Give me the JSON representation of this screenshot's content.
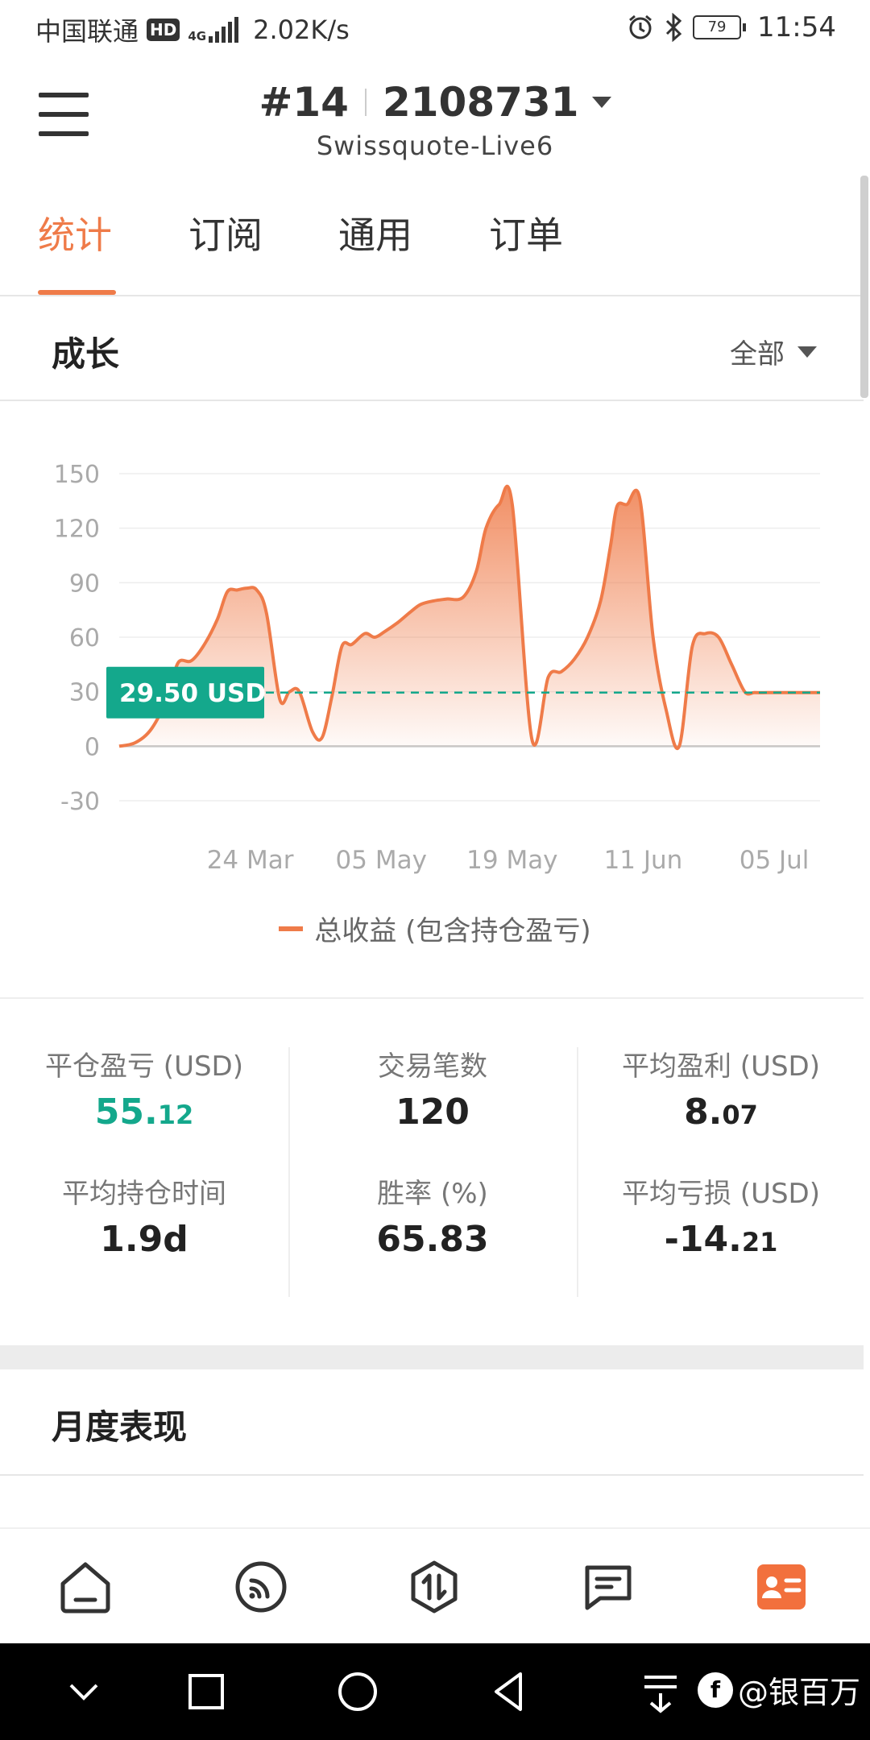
{
  "status_bar": {
    "carrier": "中国联通",
    "hd": "HD",
    "network": "4G",
    "speed": "2.02K/s",
    "battery": "79",
    "time": "11:54"
  },
  "header": {
    "account_index": "#14",
    "account_number": "2108731",
    "server": "Swissquote-Live6"
  },
  "tabs": [
    {
      "label": "统计",
      "active": true
    },
    {
      "label": "订阅",
      "active": false
    },
    {
      "label": "通用",
      "active": false
    },
    {
      "label": "订单",
      "active": false
    }
  ],
  "growth": {
    "title": "成长",
    "filter": "全部"
  },
  "chart_data": {
    "type": "area",
    "legend": "总收益 (包含持仓盈亏)",
    "series_color": "#ef7b49",
    "current_value_label": "29.50 USD",
    "current_value": 29.5,
    "ylim": [
      -30,
      150
    ],
    "y_ticks": [
      150,
      120,
      90,
      60,
      30,
      0,
      -30
    ],
    "x_ticks": [
      "24 Mar",
      "05 May",
      "19 May",
      "11 Jun",
      "05 Jul"
    ],
    "x_tick_positions": [
      2,
      4,
      6,
      8,
      10
    ],
    "xlim": [
      0,
      10.7
    ],
    "grid": true,
    "series": [
      {
        "name": "总收益 (包含持仓盈亏)",
        "x": [
          0,
          0.25,
          0.5,
          0.75,
          0.9,
          1.1,
          1.3,
          1.5,
          1.65,
          1.8,
          1.95,
          2.1,
          2.25,
          2.45,
          2.6,
          2.75,
          2.95,
          3.1,
          3.25,
          3.4,
          3.55,
          3.75,
          3.9,
          4.05,
          4.25,
          4.45,
          4.6,
          4.8,
          5.0,
          5.25,
          5.45,
          5.6,
          5.8,
          6.0,
          6.3,
          6.55,
          6.75,
          6.95,
          7.15,
          7.35,
          7.5,
          7.6,
          7.75,
          7.95,
          8.15,
          8.35,
          8.55,
          8.75,
          8.95,
          9.15,
          9.35,
          9.55,
          9.7,
          9.9,
          10.05,
          10.2,
          10.35,
          10.5,
          10.7
        ],
        "y": [
          0,
          2,
          10,
          28,
          46,
          47,
          56,
          70,
          85,
          86,
          87,
          86,
          73,
          26,
          30,
          30,
          8,
          5,
          28,
          55,
          56,
          62,
          60,
          63,
          68,
          74,
          78,
          80,
          81,
          82,
          96,
          120,
          133,
          133,
          4,
          38,
          41,
          48,
          60,
          80,
          110,
          132,
          133,
          136,
          60,
          20,
          0,
          55,
          62,
          60,
          45,
          30,
          29.5,
          29.5,
          29.5,
          29.5,
          29.5,
          29.5,
          29.5
        ]
      }
    ]
  },
  "stats": {
    "closed_pnl": {
      "label": "平仓盈亏 (USD)",
      "int": "55.",
      "dec": "12"
    },
    "trade_count": {
      "label": "交易笔数",
      "value": "120"
    },
    "avg_profit": {
      "label": "平均盈利 (USD)",
      "int": "8.",
      "dec": "07"
    },
    "avg_hold": {
      "label": "平均持仓时间",
      "value": "1.9d"
    },
    "win_rate": {
      "label": "胜率 (%)",
      "value": "65.83"
    },
    "avg_loss": {
      "label": "平均亏损 (USD)",
      "int": "-14.",
      "dec": "21"
    }
  },
  "monthly": {
    "title": "月度表现"
  },
  "bottom_nav": [
    {
      "icon": "home-icon"
    },
    {
      "icon": "feed-icon"
    },
    {
      "icon": "trade-icon"
    },
    {
      "icon": "message-icon"
    },
    {
      "icon": "profile-card-icon",
      "active": true
    }
  ],
  "watermark": "@银百万"
}
